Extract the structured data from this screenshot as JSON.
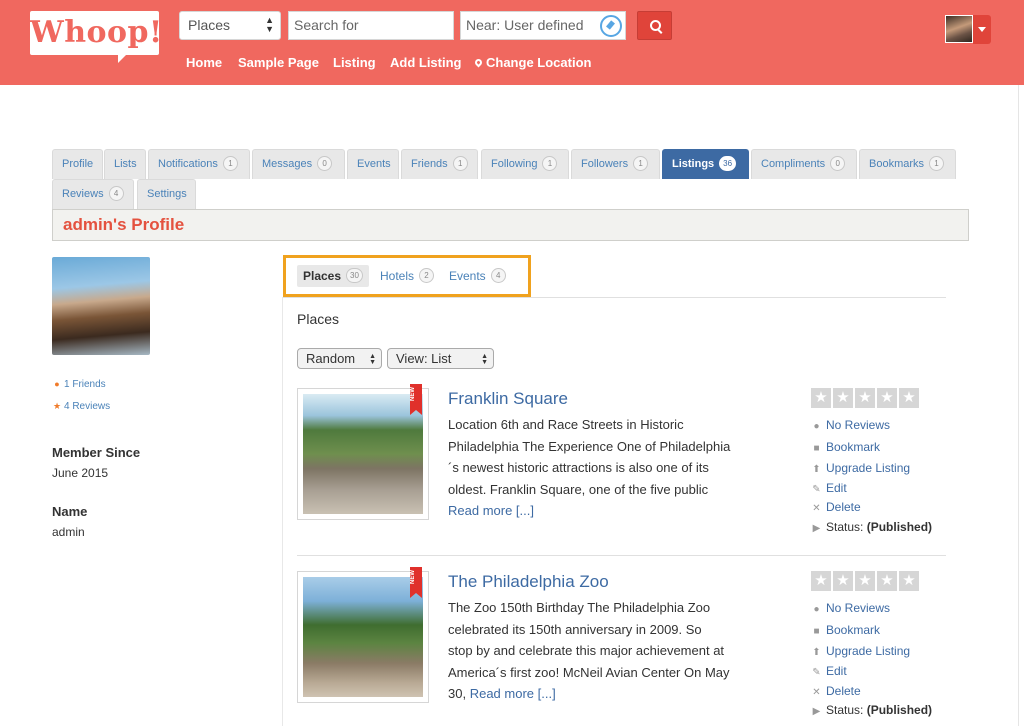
{
  "header": {
    "logo_text": "Whoop!",
    "search_type": "Places",
    "search_placeholder": "Search for",
    "near_value": "Near: User defined",
    "nav": [
      "Home",
      "Sample Page",
      "Listing",
      "Add Listing",
      "Change Location"
    ]
  },
  "profile_tabs": [
    {
      "label": "Profile"
    },
    {
      "label": "Lists"
    },
    {
      "label": "Notifications",
      "count": "1"
    },
    {
      "label": "Messages",
      "count": "0"
    },
    {
      "label": "Events"
    },
    {
      "label": "Friends",
      "count": "1"
    },
    {
      "label": "Following",
      "count": "1"
    },
    {
      "label": "Followers",
      "count": "1"
    },
    {
      "label": "Listings",
      "count": "36"
    },
    {
      "label": "Compliments",
      "count": "0"
    },
    {
      "label": "Bookmarks",
      "count": "1"
    },
    {
      "label": "Reviews",
      "count": "4"
    },
    {
      "label": "Settings"
    }
  ],
  "profile_title": "admin's Profile",
  "sidebar": {
    "friends": "1 Friends",
    "reviews": "4 Reviews",
    "member_since_label": "Member Since",
    "member_since_value": "June 2015",
    "name_label": "Name",
    "name_value": "admin"
  },
  "sub_tabs": [
    {
      "label": "Places",
      "count": "30"
    },
    {
      "label": "Hotels",
      "count": "2"
    },
    {
      "label": "Events",
      "count": "4"
    }
  ],
  "section_label": "Places",
  "sort_select": "Random",
  "view_select": "View: List",
  "listings": [
    {
      "ribbon": "NEW",
      "title": "Franklin Square",
      "desc_lines": [
        "Location 6th and Race Streets in Historic",
        "Philadelphia The Experience One of Philadelphia",
        "´s newest historic attractions is also one of its",
        "oldest. Franklin Square, one of the five public"
      ],
      "desc_tail": "",
      "more": "Read more [...]",
      "reviews": "No Reviews",
      "bookmark": "Bookmark",
      "upgrade": "Upgrade Listing",
      "edit": "Edit",
      "delete": "Delete",
      "status_label": "Status:",
      "status_value": "(Published)"
    },
    {
      "ribbon": "NEW",
      "title": "The Philadelphia Zoo",
      "desc_lines": [
        "The Zoo 150th Birthday The Philadelphia Zoo",
        "celebrated its 150th anniversary in 2009. So",
        "stop by and celebrate this major achievement at",
        "America´s first zoo! McNeil Avian Center On May"
      ],
      "desc_tail": "30,",
      "more": "Read more [...]",
      "reviews": "No Reviews",
      "bookmark": "Bookmark",
      "upgrade": "Upgrade Listing",
      "edit": "Edit",
      "delete": "Delete",
      "status_label": "Status:",
      "status_value": "(Published)"
    }
  ],
  "colors": {
    "header_bg": "#f0685f",
    "accent_blue": "#3d6aa3",
    "title_red": "#e4523f",
    "highlight_orange": "#f0a21e"
  }
}
